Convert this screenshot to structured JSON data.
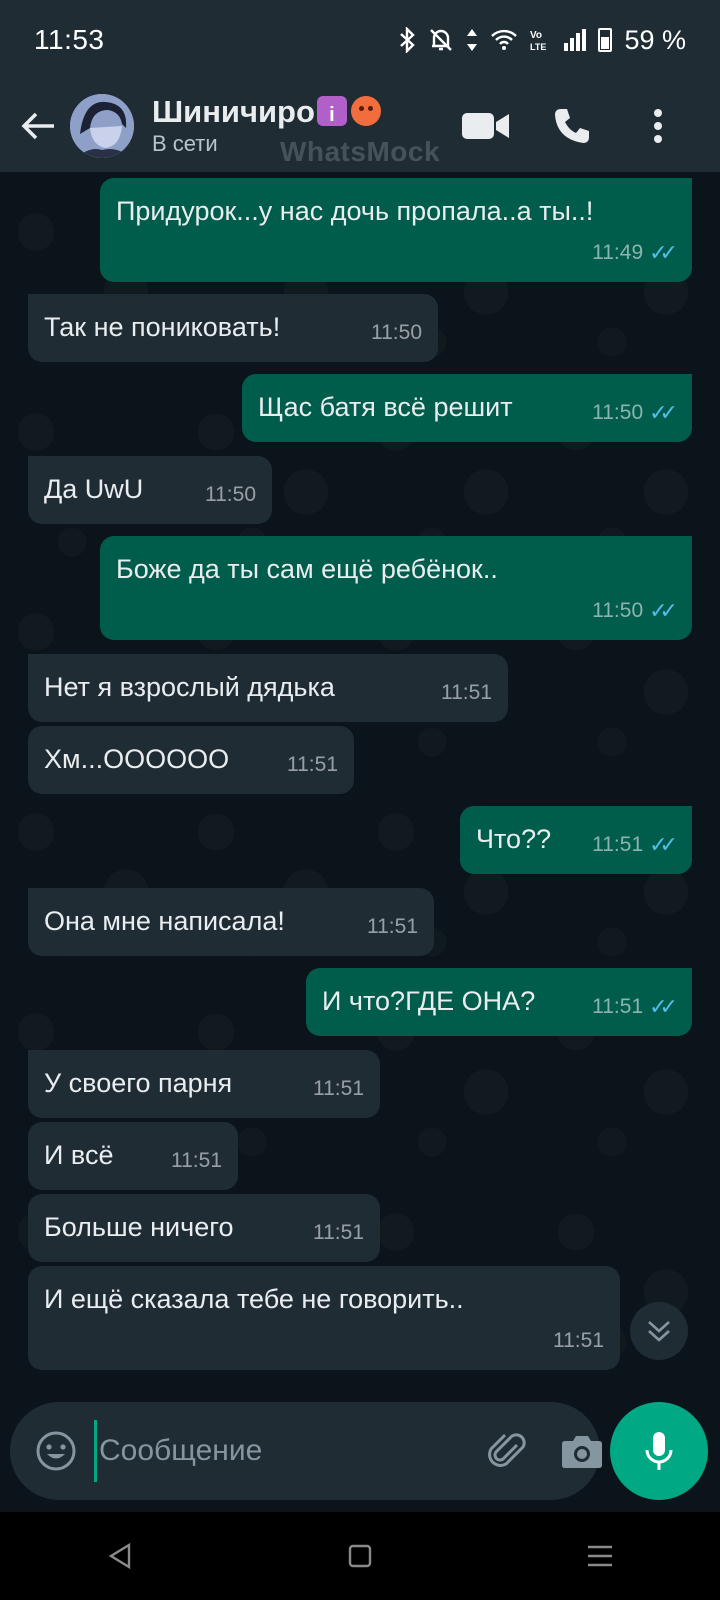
{
  "status_bar": {
    "time": "11:53",
    "battery": "59 %",
    "icons": [
      "bluetooth-icon",
      "mute-icon",
      "data-arrows-icon",
      "wifi-icon",
      "volte-icon",
      "signal-icon",
      "battery-icon"
    ]
  },
  "header": {
    "contact_name": "Шиничиро",
    "contact_status": "В сети",
    "watermark": "WhatsMock",
    "icons": [
      "back-arrow-icon",
      "video-call-icon",
      "phone-call-icon",
      "more-options-icon"
    ]
  },
  "messages": [
    {
      "dir": "out",
      "text": "Придурок...у нас дочь пропала..а ты..!",
      "time": "11:49",
      "read": true
    },
    {
      "dir": "in",
      "text": "Так не пониковать!",
      "time": "11:50"
    },
    {
      "dir": "out",
      "text": "Щас батя всё решит",
      "time": "11:50",
      "read": true
    },
    {
      "dir": "in",
      "text": "Да UwU",
      "time": "11:50"
    },
    {
      "dir": "out",
      "text": "Боже да ты сам ещё ребёнок..",
      "time": "11:50",
      "read": true
    },
    {
      "dir": "in",
      "text": "Нет я взрослый дядька",
      "time": "11:51"
    },
    {
      "dir": "in",
      "text": "Хм...OOOOOO",
      "time": "11:51"
    },
    {
      "dir": "out",
      "text": "Что??",
      "time": "11:51",
      "read": true
    },
    {
      "dir": "in",
      "text": "Она мне написала!",
      "time": "11:51"
    },
    {
      "dir": "out",
      "text": "И что?ГДЕ ОНА?",
      "time": "11:51",
      "read": true
    },
    {
      "dir": "in",
      "text": "У своего парня",
      "time": "11:51"
    },
    {
      "dir": "in",
      "text": "И всё",
      "time": "11:51"
    },
    {
      "dir": "in",
      "text": "Больше ничего",
      "time": "11:51"
    },
    {
      "dir": "in",
      "text": "И ещё сказала тебе не говорить..",
      "time": "11:51"
    }
  ],
  "input": {
    "placeholder": "Сообщение",
    "value": ""
  },
  "colors": {
    "header_bg": "#1f2c34",
    "chat_bg": "#0b141a",
    "incoming_bubble": "#1f2c34",
    "outgoing_bubble": "#005c4b",
    "accent": "#00a884",
    "read_ticks": "#53bdeb"
  }
}
